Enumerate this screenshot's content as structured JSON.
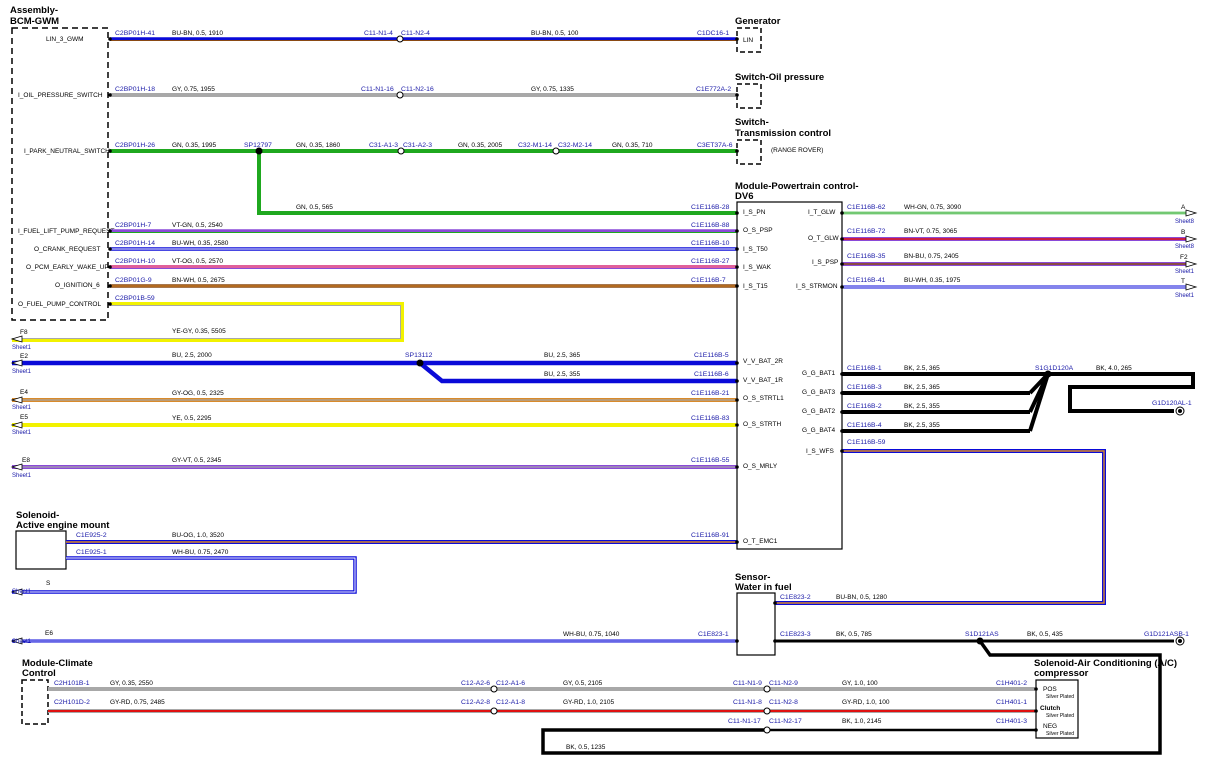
{
  "components": {
    "bcm": "Assembly-BCM-GWM",
    "bcm_l1": "Assembly-",
    "bcm_l2": "BCM-GWM",
    "generator": "Generator",
    "oil_switch": "Switch-Oil pressure",
    "tcs_l1": "Switch-",
    "tcs_l2": "Transmission control",
    "tcs_note": "(RANGE ROVER)",
    "pcm_l1": "Module-Powertrain control-",
    "pcm_l2": "DV6",
    "aem_l1": "Solenoid-",
    "aem_l2": "Active engine mount",
    "wif_l1": "Sensor-",
    "wif_l2": "Water in fuel",
    "cc_l1": "Module-Climate",
    "cc_l2": "Control",
    "ac_l1": "Solenoid-Air Conditioning (A/C)",
    "ac_l2": "compressor"
  },
  "bcm_pins": [
    "LIN_3_GWM",
    "I_OIL_PRESSURE_SWITCH",
    "I_PARK_NEUTRAL_SWITCH",
    "I_FUEL_LIFT_PUMP_REQUEST",
    "O_CRANK_REQUEST",
    "O_PCM_EARLY_WAKE_UP",
    "O_IGNITION_6",
    "O_FUEL_PUMP_CONTROL"
  ],
  "pcm_left_pins": [
    "I_S_PN",
    "O_S_PSP",
    "I_S_T50",
    "I_S_WAK",
    "I_S_T15",
    "V_V_BAT_2R",
    "V_V_BAT_1R",
    "O_S_STRTL1",
    "O_S_STRTH",
    "O_S_MRLY",
    "O_T_EMC1"
  ],
  "pcm_right_pins": [
    "I_T_GLW",
    "O_T_GLW",
    "I_S_PSP",
    "I_S_STRMON",
    "G_G_BAT1",
    "G_G_BAT3",
    "G_G_BAT2",
    "G_G_BAT4",
    "I_S_WFS"
  ],
  "generator_pin": "LIN",
  "ac_pins": {
    "pos": "POS",
    "clutch": "Clutch",
    "neg": "NEG",
    "plating": "Silver Plated"
  },
  "connectors": {
    "c1": "C2BP01H-41",
    "c2": "C11-N1-4",
    "c3": "C11-N2-4",
    "c4": "C1DC16-1",
    "c5": "C2BP01H-18",
    "c6": "C11-N1-16",
    "c7": "C11-N2-16",
    "c8": "C1E772A-2",
    "c9": "C2BP01H-26",
    "c10": "SP12797",
    "c11": "C31-A1-3",
    "c12": "C31-A2-3",
    "c13": "C32-M1-14",
    "c14": "C32-M2-14",
    "c15": "C3ET37A-6",
    "c16": "C1E116B-28",
    "c17": "C2BP01H-7",
    "c18": "C1E116B-88",
    "c19": "C2BP01H-14",
    "c20": "C1E116B-10",
    "c21": "C2BP01H-10",
    "c22": "C1E116B-27",
    "c23": "C2BP01G-9",
    "c24": "C1E116B-7",
    "c25": "C2BP01B-59",
    "c26": "C1E116B-62",
    "c27": "C1E116B-72",
    "c28": "C1E116B-35",
    "c29": "C1E116B-41",
    "c30": "SP13112",
    "c31": "C1E116B-5",
    "c32": "C1E116B-6",
    "c33": "C1E116B-21",
    "c34": "C1E116B-83",
    "c35": "C1E116B-55",
    "c36": "C1E116B-1",
    "c37": "C1E116B-3",
    "c38": "C1E116B-2",
    "c39": "C1E116B-4",
    "c40": "C1E116B-59",
    "c41": "S1G1D120A",
    "c42": "G1D120AL-1",
    "c43": "C1E925-2",
    "c44": "C1E116B-91",
    "c45": "C1E925-1",
    "c46": "C1E823-2",
    "c47": "C1E823-1",
    "c48": "C1E823-3",
    "c49": "S1D121AS",
    "c50": "G1D121ASB-1",
    "c51": "C2H101B-1",
    "c52": "C12-A2-6",
    "c53": "C12-A1-6",
    "c54": "C11-N1-9",
    "c55": "C11-N2-9",
    "c56": "C1H401-2",
    "c57": "C2H101D-2",
    "c58": "C12-A2-8",
    "c59": "C12-A1-8",
    "c60": "C11-N1-8",
    "c61": "C11-N2-8",
    "c62": "C1H401-1",
    "c63": "C11-N1-17",
    "c64": "C11-N2-17",
    "c65": "C1H401-3"
  },
  "wires": {
    "w1": "BU-BN,  0.5,  1910",
    "w2": "BU-BN,  0.5,  100",
    "w3": "GY,  0.75,  1955",
    "w4": "GY,  0.75,  1335",
    "w5": "GN,  0.35,  1995",
    "w6": "GN,  0.35,  1860",
    "w7": "GN,  0.35,  2005",
    "w8": "GN,  0.35,  710",
    "w9": "GN,  0.5,  565",
    "w10": "VT-GN,  0.5,  2540",
    "w11": "BU-WH,  0.35,  2580",
    "w12": "VT-OG,  0.5,  2570",
    "w13": "BN-WH,  0.5,  2675",
    "w14": "YE-GY,  0.35,  5505",
    "w15": "WH-GN,  0.75,  3090",
    "w16": "BN-VT,  0.75,  3065",
    "w17": "BN-BU,  0.75,  2405",
    "w18": "BU-WH,  0.35,  1975",
    "w19": "BU,  2.5,  2000",
    "w20": "BU,  2.5,  365",
    "w21": "BU,  2.5,  355",
    "w22": "GY-OG,  0.5,  2325",
    "w23": "YE,  0.5,  2295",
    "w24": "GY-VT,  0.5,  2345",
    "w25": "BK,  2.5,  365",
    "w26": "BK,  2.5,  365",
    "w27": "BK,  2.5,  355",
    "w28": "BK,  2.5,  355",
    "w29": "BK,  4.0,  265",
    "w30": "BU-OG,  1.0,  3520",
    "w31": "WH-BU,  0.75,  2470",
    "w32": "BU-BN,  0.5,  1280",
    "w33": "WH-BU,  0.75,  1040",
    "w34": "BK,  0.5,  785",
    "w35": "BK,  0.5,  435",
    "w36": "GY,  0.35,  2550",
    "w37": "GY,  0.5,  2105",
    "w38": "GY,  1.0,  100",
    "w39": "GY-RD,  0.75,  2485",
    "w40": "GY-RD,  1.0,  2105",
    "w41": "GY-RD,  1.0,  100",
    "w42": "BK,  1.0,  2145",
    "w43": "BK,  0.5,  1235"
  },
  "offsheet": {
    "r_a": "A",
    "r_b": "B",
    "r_f2": "F2",
    "r_t": "T",
    "l_f8": "F8",
    "l_e2": "E2",
    "l_e4": "E4",
    "l_e5": "E5",
    "l_e8": "E8",
    "l_s": "S",
    "l_e6": "E6",
    "sheet8": "Sheet8",
    "sheet1": "Sheet1"
  },
  "colors": {
    "blue": "#0a0ad8",
    "green": "#1fa81f",
    "black": "#000000",
    "yellow": "#f2f200",
    "gray": "#a8a8a8",
    "red": "#e01010",
    "orange": "#d98a2a",
    "brown": "#8a4a14",
    "violet": "#8a4ad8",
    "pink": "#e0609a"
  }
}
